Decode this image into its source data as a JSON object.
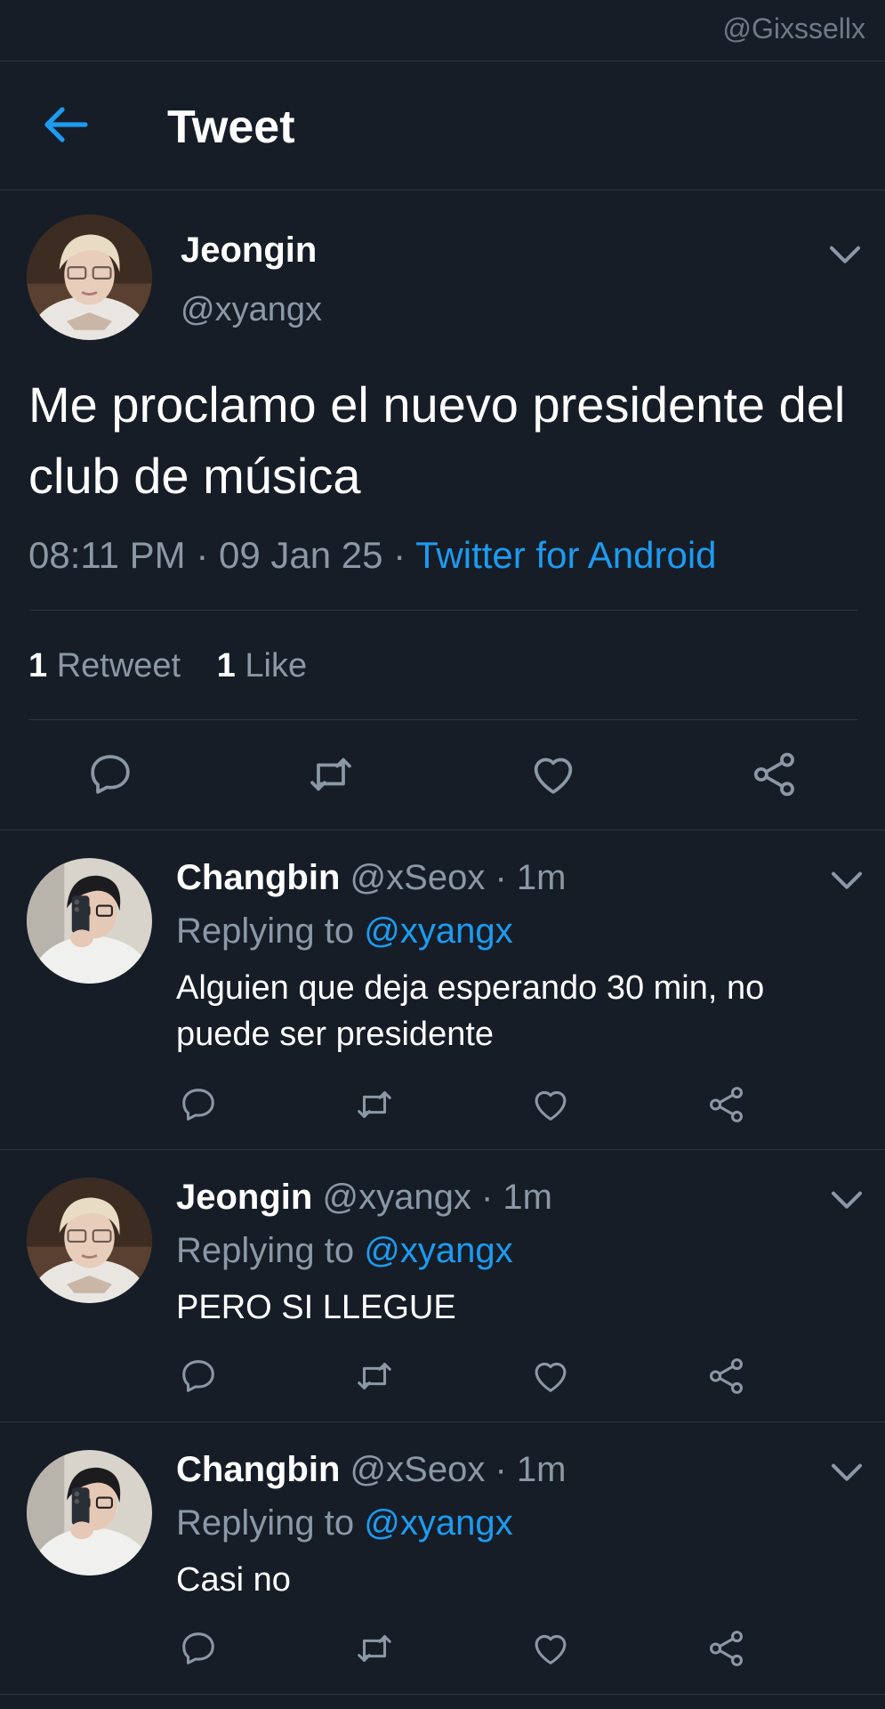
{
  "watermark": "@Gixssellx",
  "header": {
    "title": "Tweet"
  },
  "main_tweet": {
    "name": "Jeongin",
    "handle": "@xyangx",
    "text": "Me proclamo el nuevo presidente del club de música",
    "time": "08:11 PM",
    "date": "09 Jan 25",
    "source": "Twitter for Android",
    "retweets_count": "1",
    "retweets_label": "Retweet",
    "likes_count": "1",
    "likes_label": "Like"
  },
  "replies": [
    {
      "name": "Changbin",
      "handle": "@xSeox",
      "time": "1m",
      "replying_label": "Replying to",
      "replying_to": "@xyangx",
      "text": "Alguien que deja esperando 30 min, no puede ser presidente"
    },
    {
      "name": "Jeongin",
      "handle": "@xyangx",
      "time": "1m",
      "replying_label": "Replying to",
      "replying_to": "@xyangx",
      "text": "PERO SI LLEGUE"
    },
    {
      "name": "Changbin",
      "handle": "@xSeox",
      "time": "1m",
      "replying_label": "Replying to",
      "replying_to": "@xyangx",
      "text": "Casi no"
    }
  ],
  "colors": {
    "background": "#161d27",
    "accent": "#1d9bf0",
    "secondary": "#8b98a5",
    "divider": "#2c3641"
  },
  "icons": [
    "arrow-left-icon",
    "chevron-down-icon",
    "reply-icon",
    "retweet-icon",
    "like-icon",
    "share-icon"
  ]
}
